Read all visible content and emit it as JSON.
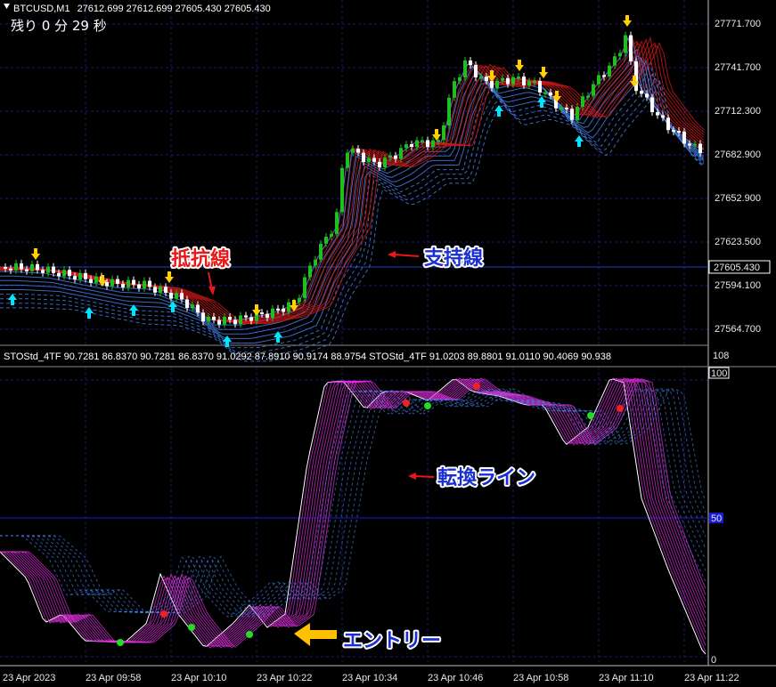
{
  "header": {
    "symbol": "BTCUSD,M1",
    "ohlc": "27612.699 27612.699 27605.430 27605.430",
    "countdown": "残り 0 分 29 秒"
  },
  "price_axis": {
    "labels": [
      "27771.700",
      "27741.700",
      "27712.300",
      "27682.900",
      "27652.900",
      "27623.500",
      "27594.100",
      "27564.700"
    ],
    "current": "27605.430",
    "current_color": "#ffffff"
  },
  "indicator": {
    "header": "STOStd_4TF 90.7281 86.8370 90.7281 86.8370 91.0292 87.8910 90.9174 88.9754   STOStd_4TF 91.0203 89.8801 91.0110 90.4069 90.938",
    "axis_top": "108",
    "level_100": "100",
    "level_50": "50",
    "level_0": "0"
  },
  "time_axis": [
    "23 Apr 2023",
    "23 Apr 09:58",
    "23 Apr 10:10",
    "23 Apr 10:22",
    "23 Apr 10:34",
    "23 Apr 10:46",
    "23 Apr 10:58",
    "23 Apr 11:10",
    "23 Apr 11:22"
  ],
  "annotations": {
    "resistance": "抵抗線",
    "support": "支持線",
    "turn": "転換ライン",
    "entry": "エントリー"
  },
  "colors": {
    "bull": "#1fbf1f",
    "bear": "#ffffff",
    "grid": "#1a1a7a",
    "ribbon_red": "#d01818",
    "ribbon_blue": "#4a8cff",
    "stoch_magenta": "#e030e0",
    "arrow_up": "#00e5ff",
    "arrow_down": "#ffd000",
    "resistance_text": "#e81818",
    "support_text": "#1a2fd0",
    "entry_arrow": "#ffc000"
  }
}
